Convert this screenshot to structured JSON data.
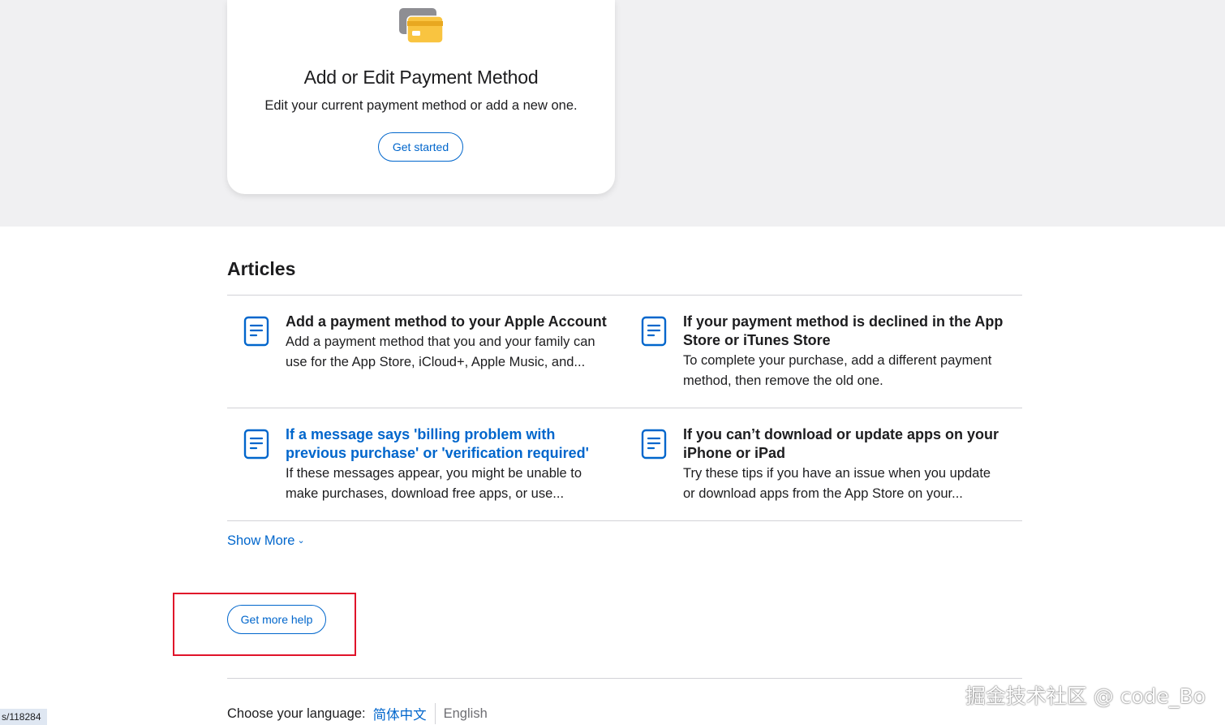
{
  "card": {
    "icon": "credit-card-icon",
    "title": "Add or Edit Payment Method",
    "description": "Edit your current payment method or add a new one.",
    "button_label": "Get started"
  },
  "articles": {
    "heading": "Articles",
    "items": [
      {
        "icon": "document-icon",
        "title": "Add a payment method to your Apple Account",
        "desc_line1": "Add a payment method that you and your family can",
        "desc_line2": "use for the App Store, iCloud+, Apple Music, and..."
      },
      {
        "icon": "document-icon",
        "title_line1": "If your payment method is declined in the App",
        "title_line2": "Store or iTunes Store",
        "desc_line1": "To complete your purchase, add a different payment",
        "desc_line2": "method, then remove the old one."
      },
      {
        "icon": "document-icon",
        "title_line1": "If a message says 'billing problem with",
        "title_line2": "previous purchase' or 'verification required'",
        "desc_line1": "If these messages appear, you might be unable to",
        "desc_line2": "make purchases, download free apps, or use..."
      },
      {
        "icon": "document-icon",
        "title_line1": "If you can’t download or update apps on your",
        "title_line2": "iPhone or iPad",
        "desc_line1": "Try these tips if you have an issue when you update",
        "desc_line2": "or download apps from the App Store on your..."
      }
    ],
    "show_more_label": "Show More",
    "show_more_icon": "chevron-down-icon"
  },
  "help": {
    "button_label": "Get more help"
  },
  "language": {
    "label": "Choose your language:",
    "options": [
      "简体中文",
      "English"
    ]
  },
  "url_fragment": "s/118284",
  "watermark": "掘金技术社区 @ code_Bo",
  "colors": {
    "link_blue": "#0066cc",
    "band_gray": "#f0f0f2",
    "highlight_red": "#e0132a",
    "card_icon_yellow": "#f9c440"
  }
}
